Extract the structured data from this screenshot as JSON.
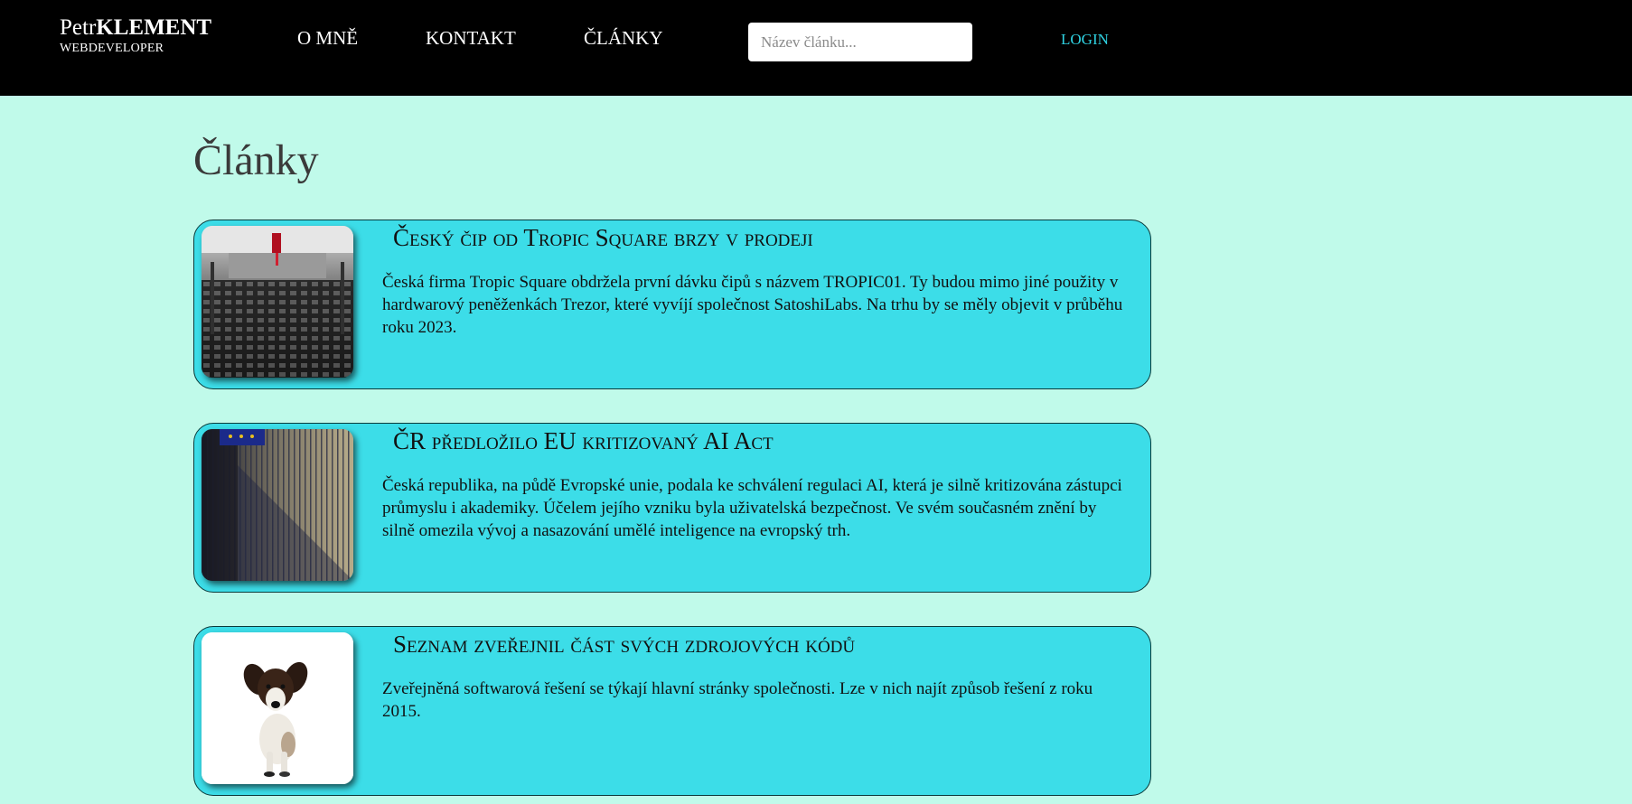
{
  "brand": {
    "first": "Petr",
    "last": "KLEMENT",
    "subtitle": "WEBDEVELOPER"
  },
  "nav": {
    "items": [
      {
        "label": "O MNĚ"
      },
      {
        "label": "KONTAKT"
      },
      {
        "label": "ČLÁNKY"
      }
    ],
    "search_placeholder": "Název článku...",
    "search_value": "",
    "login": "LOGIN"
  },
  "colors": {
    "topbar": "#000000",
    "page_background": "#c0faea",
    "card_background": "#3cdde8",
    "login_accent": "#2fd3e3"
  },
  "main": {
    "title": "Články",
    "articles": [
      {
        "title": "Český čip od Tropic Square brzy v prodeji",
        "text": "Česká firma Tropic Square obdržela první dávku čipů s názvem TROPIC01. Ty budou mimo jiné použity v hardwarový peněženkách Trezor, které vyvíjí společnost SatoshiLabs. Na trhu by se měly objevit v průběhu roku 2023.",
        "image": "chip-machine-image"
      },
      {
        "title": "ČR předložilo EU kritizovaný AI Act",
        "text": "Česká republika, na půdě Evropské unie, podala ke schválení regulaci AI, která je silně kritizována zástupci průmyslu i akademiky. Účelem jejího vzniku byla uživatelská bezpečnost. Ve svém současném znění by silně omezila vývoj a nasazování umělé inteligence na evropský trh.",
        "image": "eu-building-image"
      },
      {
        "title": "Seznam zveřejnil část svých zdrojových kódů",
        "text": "Zveřejněná softwarová řešení se týkají hlavní stránky společnosti. Lze v nich najít způsob řešení z roku 2015.",
        "image": "dog-image"
      }
    ]
  }
}
